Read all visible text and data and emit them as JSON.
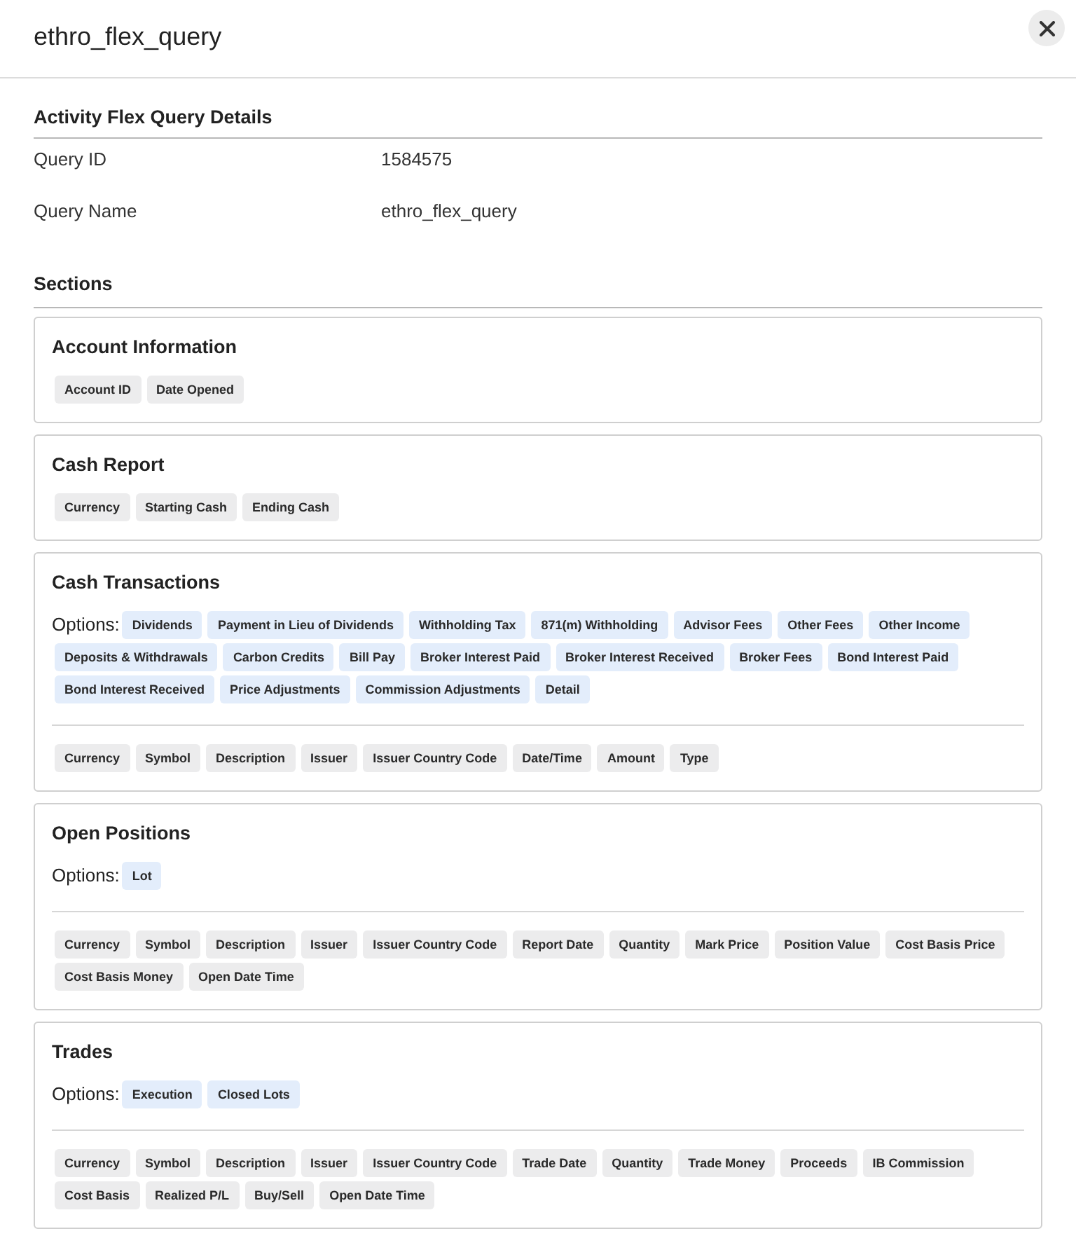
{
  "dialog": {
    "title": "ethro_flex_query"
  },
  "details": {
    "heading": "Activity Flex Query Details",
    "rows": [
      {
        "label": "Query ID",
        "value": "1584575"
      },
      {
        "label": "Query Name",
        "value": "ethro_flex_query"
      }
    ]
  },
  "sections": {
    "heading": "Sections",
    "items": [
      {
        "title": "Account Information",
        "fields": [
          "Account ID",
          "Date Opened"
        ]
      },
      {
        "title": "Cash Report",
        "fields": [
          "Currency",
          "Starting Cash",
          "Ending Cash"
        ]
      },
      {
        "title": "Cash Transactions",
        "options_label": "Options:",
        "options": [
          "Dividends",
          "Payment in Lieu of Dividends",
          "Withholding Tax",
          "871(m) Withholding",
          "Advisor Fees",
          "Other Fees",
          "Other Income",
          "Deposits & Withdrawals",
          "Carbon Credits",
          "Bill Pay",
          "Broker Interest Paid",
          "Broker Interest Received",
          "Broker Fees",
          "Bond Interest Paid",
          "Bond Interest Received",
          "Price Adjustments",
          "Commission Adjustments",
          "Detail"
        ],
        "fields": [
          "Currency",
          "Symbol",
          "Description",
          "Issuer",
          "Issuer Country Code",
          "Date/Time",
          "Amount",
          "Type"
        ]
      },
      {
        "title": "Open Positions",
        "options_label": "Options:",
        "options": [
          "Lot"
        ],
        "fields": [
          "Currency",
          "Symbol",
          "Description",
          "Issuer",
          "Issuer Country Code",
          "Report Date",
          "Quantity",
          "Mark Price",
          "Position Value",
          "Cost Basis Price",
          "Cost Basis Money",
          "Open Date Time"
        ]
      },
      {
        "title": "Trades",
        "options_label": "Options:",
        "options": [
          "Execution",
          "Closed Lots"
        ],
        "fields": [
          "Currency",
          "Symbol",
          "Description",
          "Issuer",
          "Issuer Country Code",
          "Trade Date",
          "Quantity",
          "Trade Money",
          "Proceeds",
          "IB Commission",
          "Cost Basis",
          "Realized P/L",
          "Buy/Sell",
          "Open Date Time"
        ]
      }
    ]
  }
}
